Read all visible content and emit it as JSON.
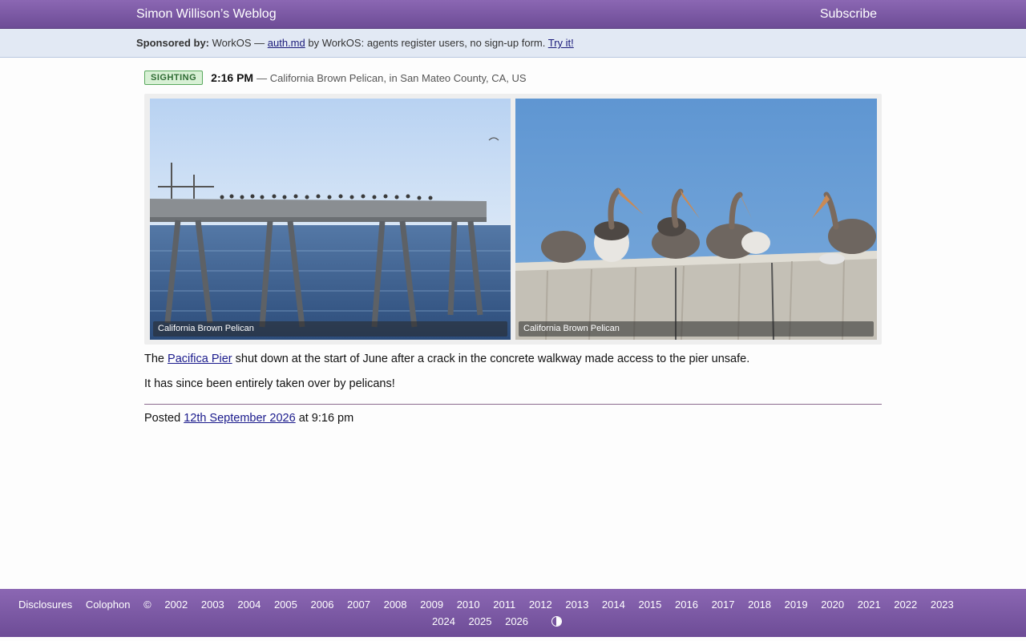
{
  "header": {
    "site_title": "Simon Willison’s Weblog",
    "subscribe_label": "Subscribe"
  },
  "sponsor": {
    "label": "Sponsored by:",
    "prefix": "WorkOS —",
    "link_text": "auth.md",
    "middle": "by WorkOS: agents register users, no sign-up form.",
    "cta_text": "Try it!"
  },
  "entry": {
    "badge": "SIGHTING",
    "time": "2:16 PM",
    "detail": "— California Brown Pelican, in San Mateo County, CA, US",
    "photos": [
      {
        "caption": "California Brown Pelican"
      },
      {
        "caption": "California Brown Pelican"
      }
    ],
    "para1_before": "The",
    "para1_link": "Pacifica Pier",
    "para1_after": "shut down at the start of June after a crack in the concrete walkway made access to the pier unsafe.",
    "para2": "It has since been entirely taken over by pelicans!",
    "posted_prefix": "Posted",
    "posted_link": "12th September 2026",
    "posted_suffix": "at 9:16 pm"
  },
  "footer": {
    "links": [
      "Disclosures",
      "Colophon",
      "©",
      "2002",
      "2003",
      "2004",
      "2005",
      "2006",
      "2007",
      "2008",
      "2009",
      "2010",
      "2011",
      "2012",
      "2013",
      "2014",
      "2015",
      "2016",
      "2017",
      "2018",
      "2019",
      "2020",
      "2021",
      "2022",
      "2023"
    ],
    "links_row2": [
      "2024",
      "2025",
      "2026"
    ],
    "contrast_icon": "contrast-toggle-icon"
  },
  "colors": {
    "header_bg": "#7b59a5",
    "sponsor_bg": "#e2e9f4",
    "badge_bg": "#d8f0d5",
    "link": "#1a1a8c"
  }
}
